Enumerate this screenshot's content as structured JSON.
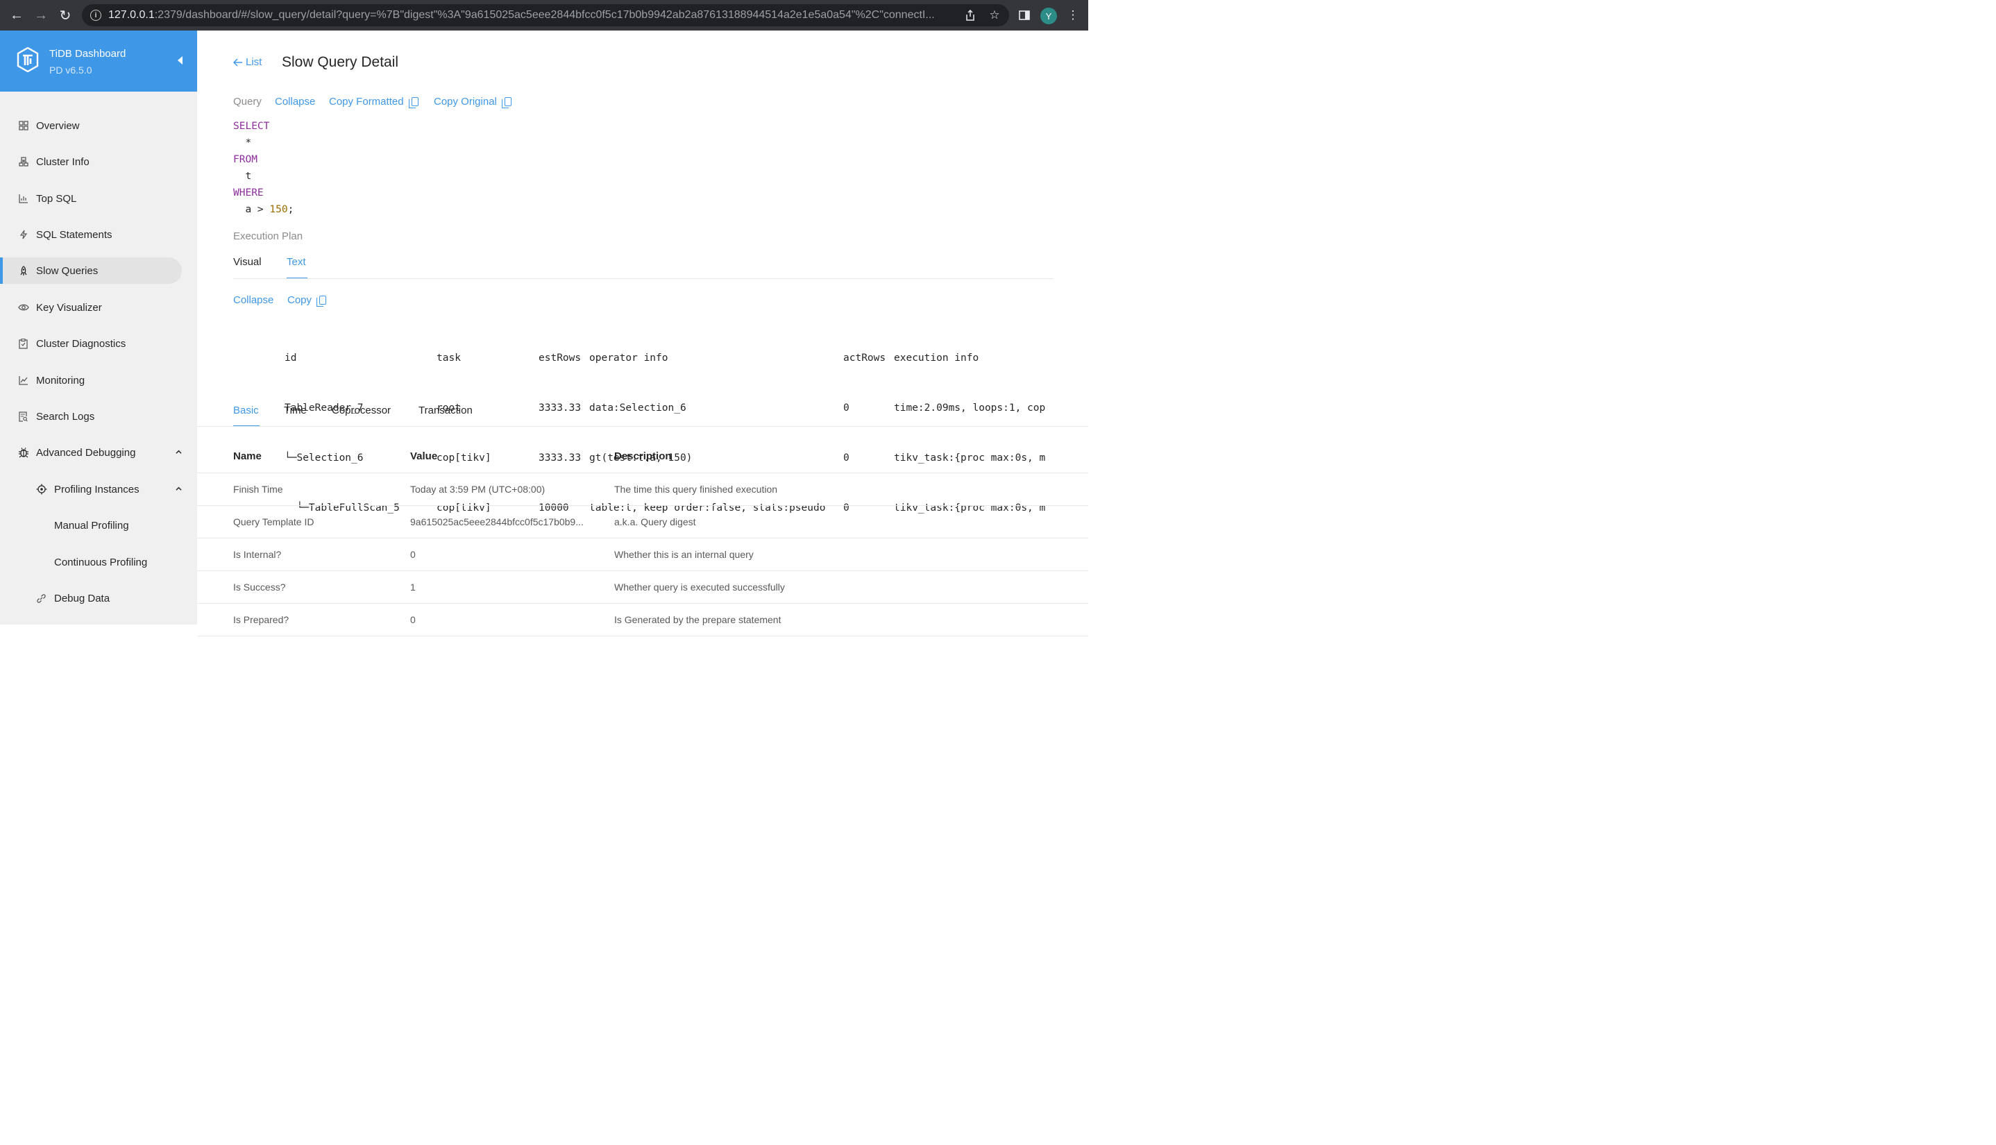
{
  "browser": {
    "url_host": "127.0.0.1",
    "url_rest": ":2379/dashboard/#/slow_query/detail?query=%7B\"digest\"%3A\"9a615025ac5eee2844bfcc0f5c17b0b9942ab2a87613188944514a2e1e5a0a54\"%2C\"connectI...",
    "profile_initial": "Y"
  },
  "sidebar": {
    "app_name": "TiDB Dashboard",
    "version": "PD v6.5.0",
    "items": [
      {
        "label": "Overview",
        "icon": "grid-icon"
      },
      {
        "label": "Cluster Info",
        "icon": "cluster-icon"
      },
      {
        "label": "Top SQL",
        "icon": "bar-chart-icon"
      },
      {
        "label": "SQL Statements",
        "icon": "lightning-icon"
      },
      {
        "label": "Slow Queries",
        "icon": "rocket-icon",
        "active": true
      },
      {
        "label": "Key Visualizer",
        "icon": "eye-icon"
      },
      {
        "label": "Cluster Diagnostics",
        "icon": "clipboard-icon"
      },
      {
        "label": "Monitoring",
        "icon": "line-chart-icon"
      },
      {
        "label": "Search Logs",
        "icon": "file-search-icon"
      },
      {
        "label": "Advanced Debugging",
        "icon": "bug-icon"
      },
      {
        "label": "Profiling Instances",
        "icon": "target-icon"
      },
      {
        "label": "Manual Profiling"
      },
      {
        "label": "Continuous Profiling"
      },
      {
        "label": "Debug Data",
        "icon": "link-icon"
      }
    ]
  },
  "header": {
    "back_label": "List",
    "title": "Slow Query Detail"
  },
  "query": {
    "label": "Query",
    "collapse": "Collapse",
    "copy_formatted": "Copy Formatted",
    "copy_original": "Copy Original",
    "lines": [
      {
        "kw": "SELECT"
      },
      {
        "indent": "  ",
        "text": "*"
      },
      {
        "kw": "FROM"
      },
      {
        "indent": "  ",
        "text": "t"
      },
      {
        "kw": "WHERE"
      },
      {
        "indent": "  ",
        "text": "a > ",
        "num": "150",
        "tail": ";"
      }
    ]
  },
  "plan": {
    "label": "Execution Plan",
    "tabs": [
      "Visual",
      "Text"
    ],
    "active_tab": "Text",
    "collapse": "Collapse",
    "copy": "Copy",
    "columns": [
      "id",
      "task",
      "estRows",
      "operator info",
      "actRows",
      "execution info"
    ],
    "rows": [
      [
        "TableReader_7",
        "root",
        "3333.33",
        "data:Selection_6",
        "0",
        "time:2.09ms, loops:1, cop"
      ],
      [
        "└─Selection_6",
        "cop[tikv]",
        "3333.33",
        "gt(test.t.a, 150)",
        "0",
        "tikv_task:{proc max:0s, m"
      ],
      [
        "  └─TableFullScan_5",
        "cop[tikv]",
        "10000",
        "table:t, keep order:false, stats:pseudo",
        "0",
        "tikv_task:{proc max:0s, m"
      ]
    ]
  },
  "detail_tabs": [
    "Basic",
    "Time",
    "Coprocessor",
    "Transaction"
  ],
  "active_detail_tab": "Basic",
  "table": {
    "headers": [
      "Name",
      "Value",
      "Description"
    ],
    "rows": [
      [
        "Finish Time",
        "Today at 3:59 PM (UTC+08:00)",
        "The time this query finished execution"
      ],
      [
        "Query Template ID",
        "9a615025ac5eee2844bfcc0f5c17b0b9...",
        "a.k.a. Query digest"
      ],
      [
        "Is Internal?",
        "0",
        "Whether this is an internal query"
      ],
      [
        "Is Success?",
        "1",
        "Whether query is executed successfully"
      ],
      [
        "Is Prepared?",
        "0",
        "Is Generated by the prepare statement"
      ]
    ]
  }
}
